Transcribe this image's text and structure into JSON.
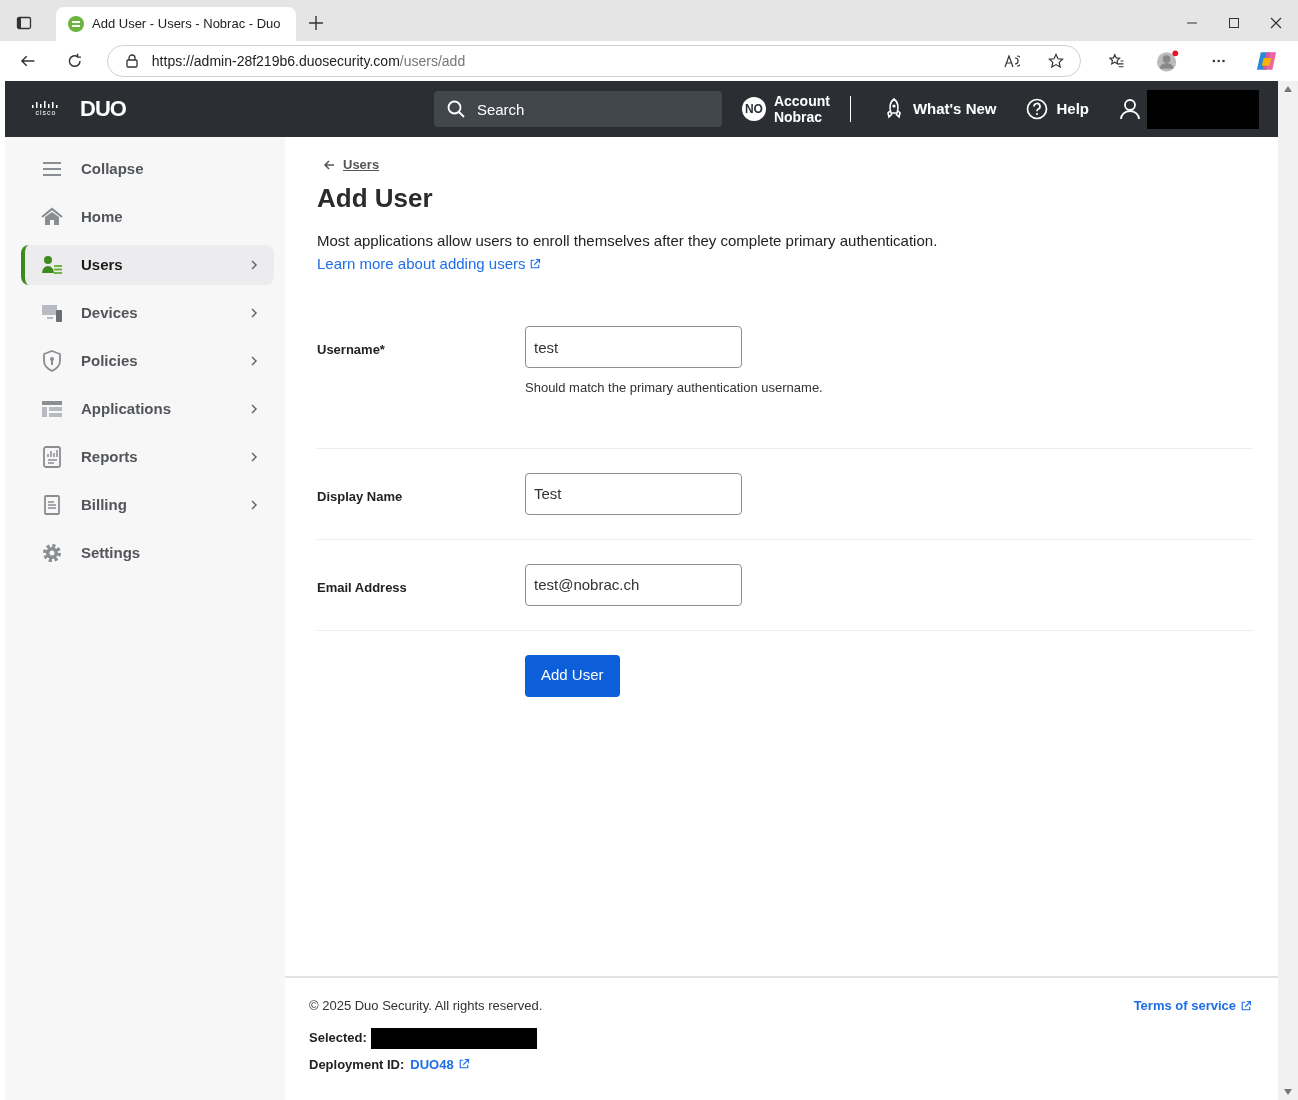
{
  "browser": {
    "tab_title": "Add User - Users - Nobrac - Duo",
    "url_host": "https://admin-28f219b6.duosecurity.com",
    "url_path": "/users/add"
  },
  "header": {
    "cisco_text": "cisco",
    "logo_text": "DUO",
    "search_placeholder": "Search",
    "account_badge": "NO",
    "account_lines": [
      "Account",
      "Nobrac"
    ],
    "whats_new": "What's New",
    "help": "Help"
  },
  "sidebar": {
    "items": [
      {
        "label": "Collapse",
        "kind": "menu",
        "has_chevron": false,
        "selected": false
      },
      {
        "label": "Home",
        "kind": "home",
        "has_chevron": false,
        "selected": false
      },
      {
        "label": "Users",
        "kind": "users",
        "has_chevron": true,
        "selected": true
      },
      {
        "label": "Devices",
        "kind": "devices",
        "has_chevron": true,
        "selected": false
      },
      {
        "label": "Policies",
        "kind": "policies",
        "has_chevron": true,
        "selected": false
      },
      {
        "label": "Applications",
        "kind": "applications",
        "has_chevron": true,
        "selected": false
      },
      {
        "label": "Reports",
        "kind": "reports",
        "has_chevron": true,
        "selected": false
      },
      {
        "label": "Billing",
        "kind": "billing",
        "has_chevron": true,
        "selected": false
      },
      {
        "label": "Settings",
        "kind": "settings",
        "has_chevron": false,
        "selected": false
      }
    ]
  },
  "main": {
    "breadcrumb": "Users",
    "title": "Add User",
    "description": "Most applications allow users to enroll themselves after they complete primary authentication.",
    "learn_more": "Learn more about adding users",
    "fields": [
      {
        "label": "Username*",
        "value": "test",
        "hint": "Should match the primary authentication username."
      },
      {
        "label": "Display Name",
        "value": "Test"
      },
      {
        "label": "Email Address",
        "value": "test@nobrac.ch"
      }
    ],
    "submit": "Add User"
  },
  "footer": {
    "copyright": "© 2025 Duo Security. All rights reserved.",
    "terms": "Terms of service",
    "selected_label": "Selected:",
    "deployment_label": "Deployment ID:",
    "deployment_id": "DUO48"
  }
}
